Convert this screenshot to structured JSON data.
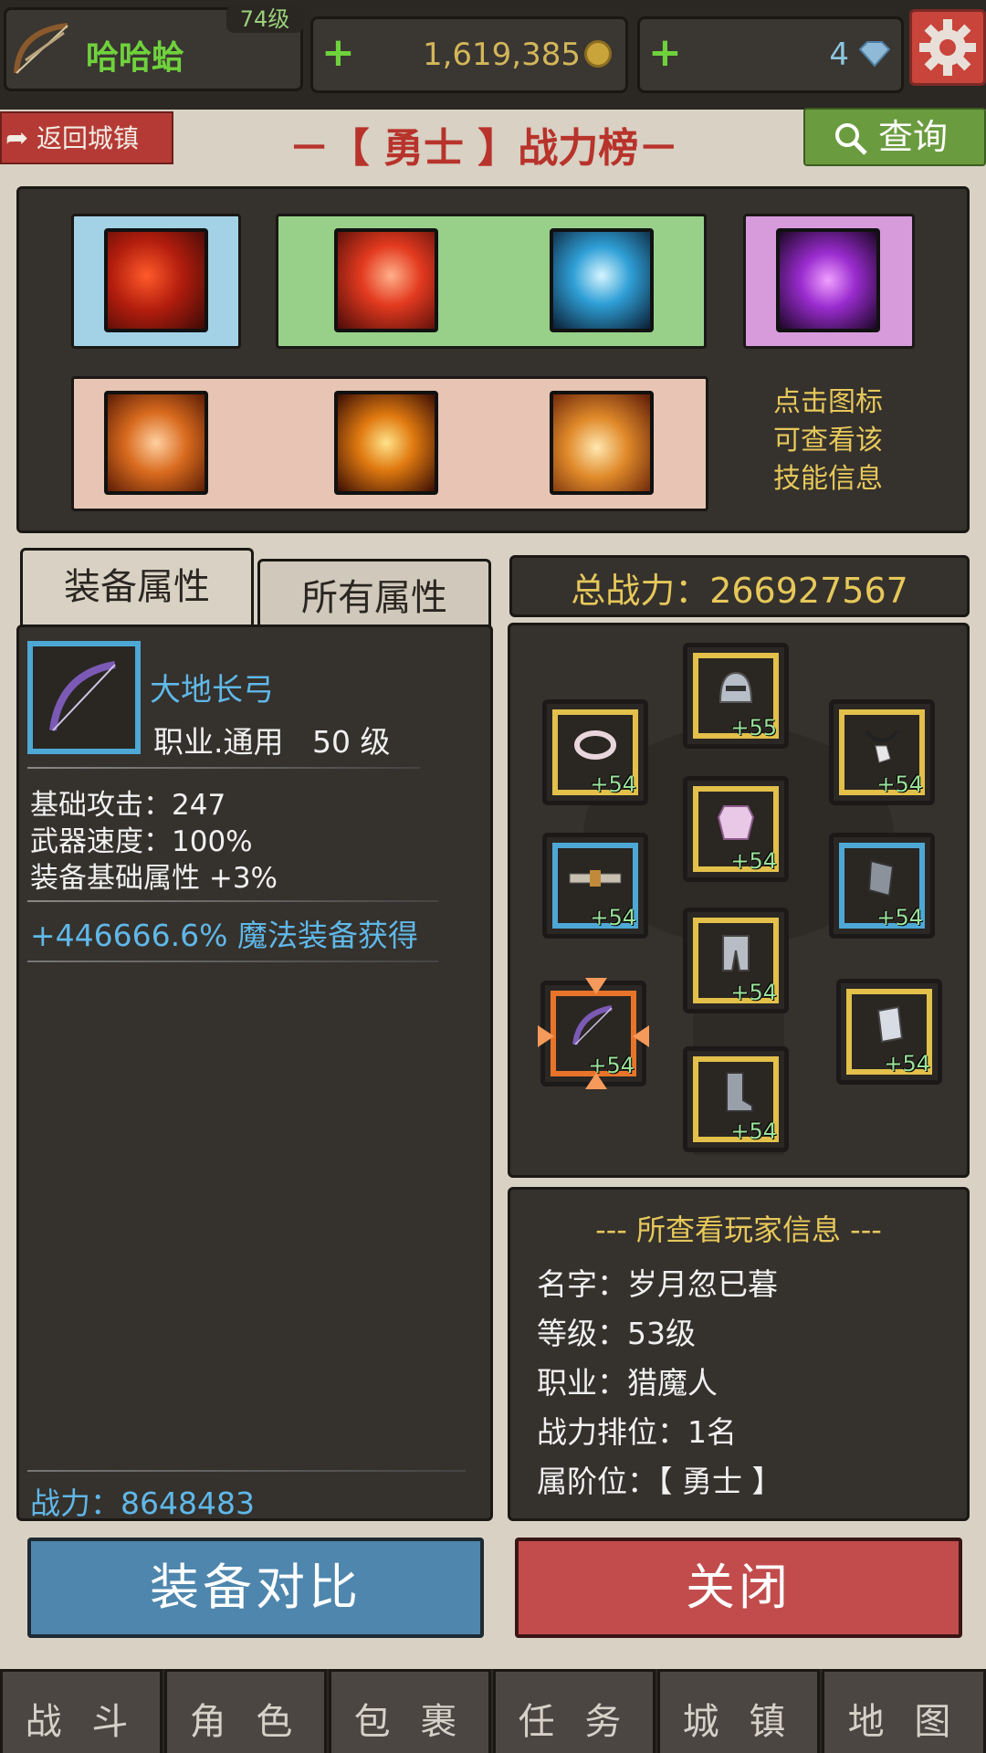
{
  "header": {
    "player_level": "74级",
    "player_name": "哈哈蛤",
    "gold": "1,619,385",
    "diamonds": "4"
  },
  "nav": {
    "back_label": "返回城镇",
    "title": "－【 勇士 】战力榜－",
    "search_label": "查询"
  },
  "skills": {
    "hint": [
      "点击图标",
      "可查看该",
      "技能信息"
    ]
  },
  "tabs": {
    "equip_attrs": "装备属性",
    "all_attrs": "所有属性"
  },
  "total_power": "总战力：266927567",
  "item": {
    "name": "大地长弓",
    "class_level": "职业.通用   50 级",
    "attrs": [
      "基础攻击：247",
      "武器速度：100%",
      "装备基础属性 +3%"
    ],
    "magic": "+446666.6% 魔法装备获得",
    "power": "战力：8648483"
  },
  "equipment": [
    {
      "slot": "helmet",
      "level": "+55",
      "frame": "gold"
    },
    {
      "slot": "ring",
      "level": "+54",
      "frame": "gold"
    },
    {
      "slot": "necklace",
      "level": "+54",
      "frame": "gold"
    },
    {
      "slot": "armor",
      "level": "+54",
      "frame": "gold"
    },
    {
      "slot": "belt",
      "level": "+54",
      "frame": "blue"
    },
    {
      "slot": "bracer",
      "level": "+54",
      "frame": "blue"
    },
    {
      "slot": "leggings",
      "level": "+54",
      "frame": "gold"
    },
    {
      "slot": "bow",
      "level": "+54",
      "frame": "orange"
    },
    {
      "slot": "gauntlet",
      "level": "+54",
      "frame": "gold"
    },
    {
      "slot": "boots",
      "level": "+54",
      "frame": "gold"
    }
  ],
  "player_info": {
    "header": "--- 所查看玩家信息 ---",
    "name": "名字：岁月忽已暮",
    "level": "等级：53级",
    "class": "职业：猎魔人",
    "rank": "战力排位：1名",
    "tier": "属阶位：【 勇士 】"
  },
  "buttons": {
    "compare": "装备对比",
    "close": "关闭"
  },
  "bottom_nav": [
    "战 斗",
    "角 色",
    "包 裹",
    "任 务",
    "城 镇",
    "地 图"
  ],
  "colors": {
    "accent_gold": "#e6c85a",
    "compare_button": "#4e86ad",
    "close_button": "#c24c4c",
    "item_name": "#5fb8e8"
  }
}
